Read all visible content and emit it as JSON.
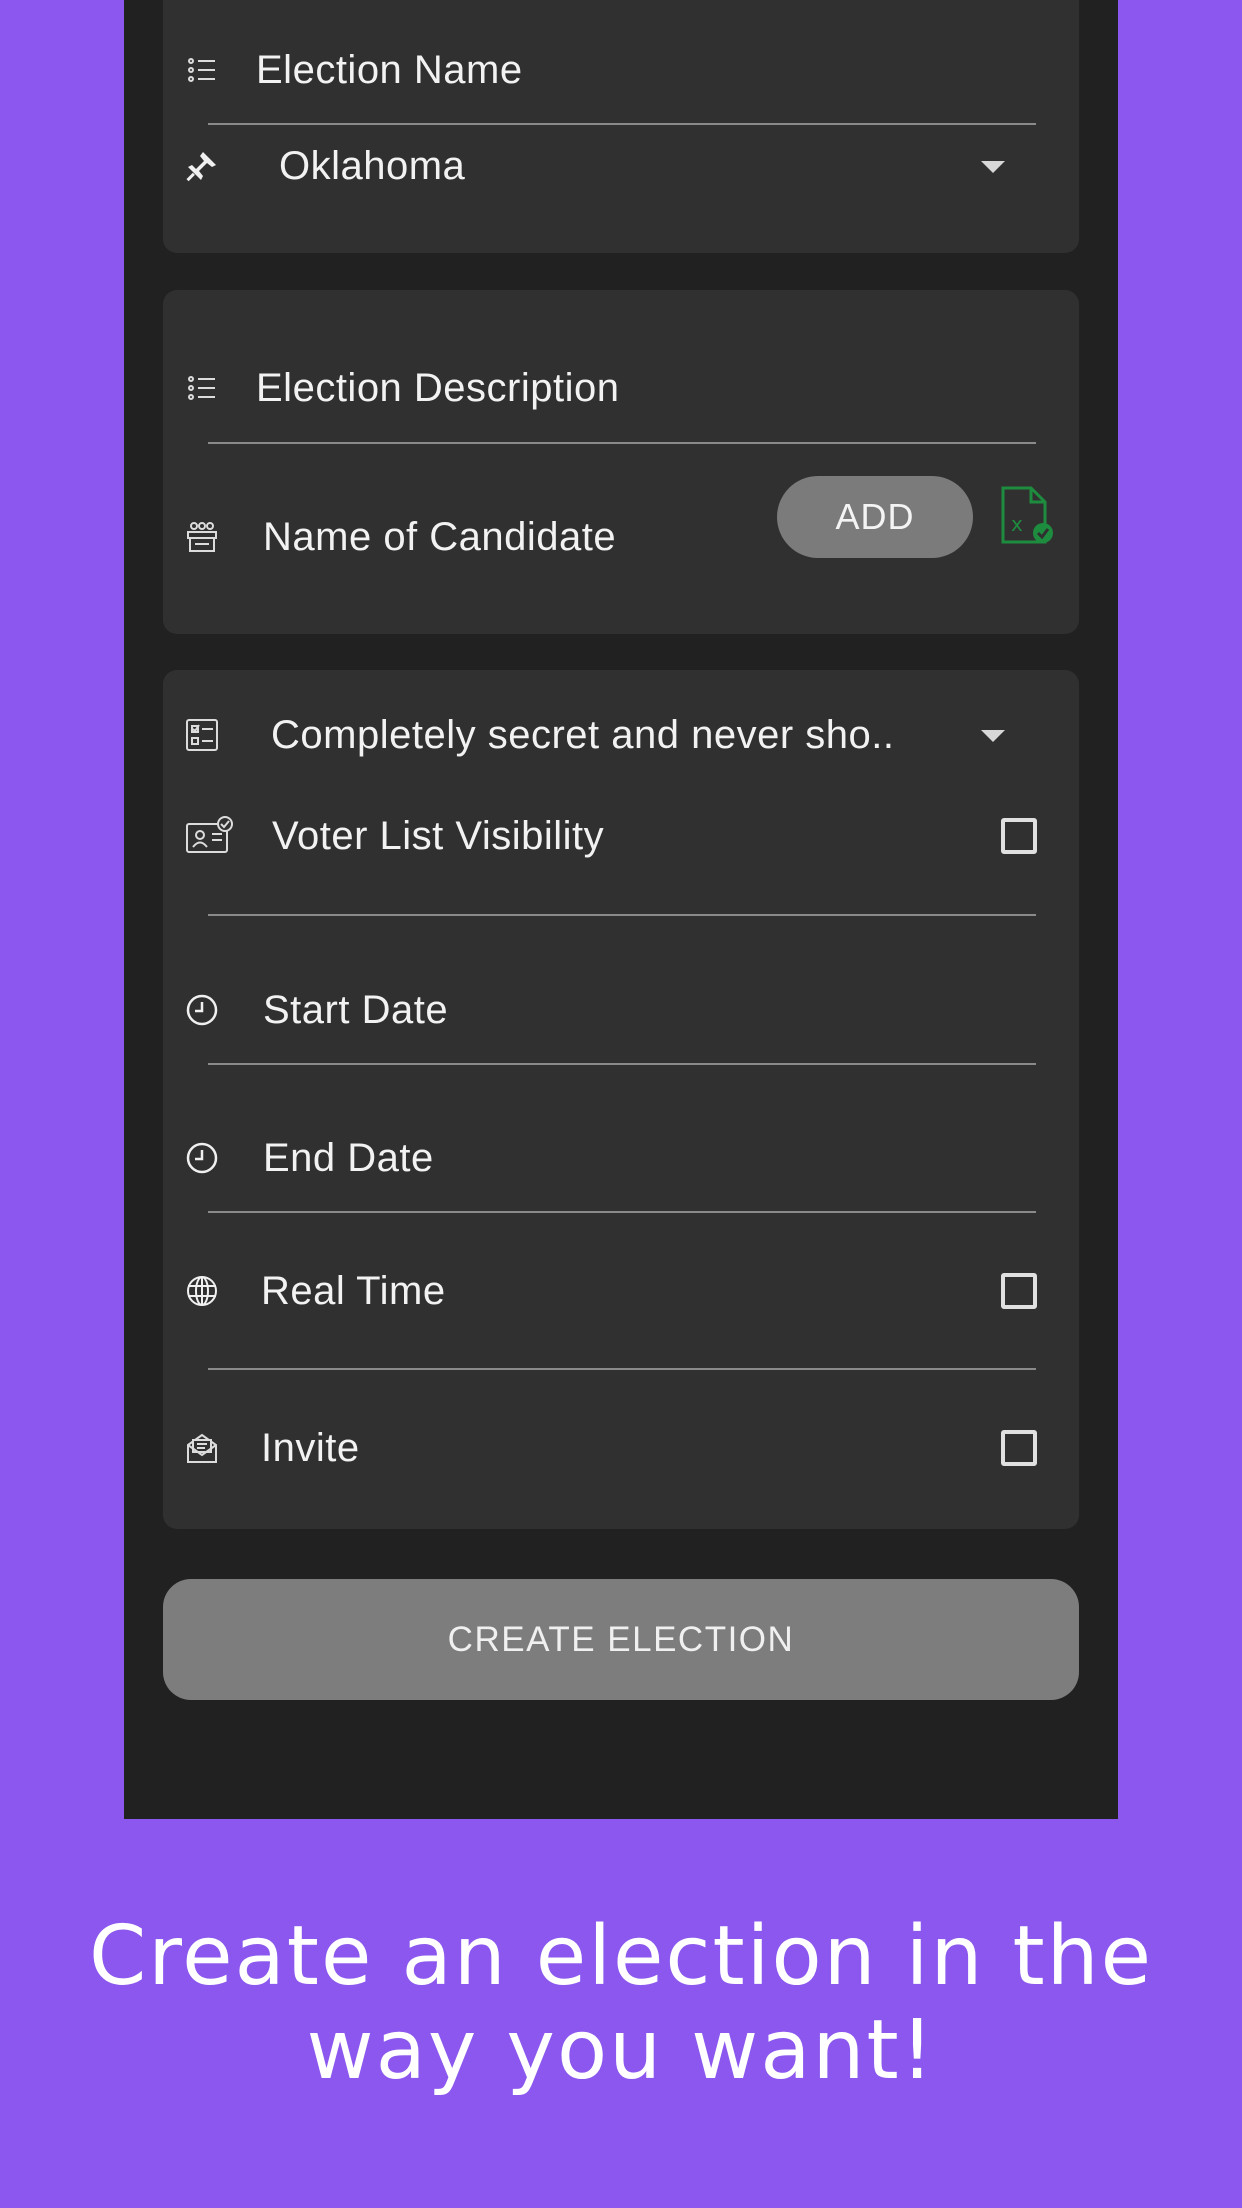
{
  "form": {
    "election_name_placeholder": "Election Name",
    "state_value": "Oklahoma",
    "election_description_placeholder": "Election Description",
    "candidate_name_placeholder": "Name of Candidate",
    "add_button_label": "ADD",
    "visibility_option": "Completely secret and never sho..",
    "voter_list_visibility_label": "Voter List Visibility",
    "start_date_placeholder": "Start Date",
    "end_date_placeholder": "End Date",
    "real_time_label": "Real Time",
    "invite_label": "Invite",
    "create_button_label": "CREATE ELECTION"
  },
  "caption": "Create an election in the way you want!",
  "colors": {
    "background": "#8b57ee",
    "panel": "#212121",
    "card": "#303030",
    "button": "#7d7d7d",
    "excel_green": "#1e8c3e"
  },
  "icons": {
    "list": "list-icon",
    "pin": "pin-icon",
    "candidates": "candidates-icon",
    "excel": "excel-import-icon",
    "ballot": "ballot-checklist-icon",
    "voter_card": "voter-id-card-icon",
    "clock": "clock-icon",
    "globe": "globe-icon",
    "envelope": "envelope-icon"
  }
}
